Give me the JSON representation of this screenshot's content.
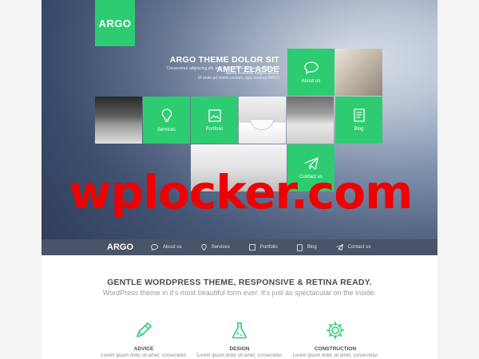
{
  "brand": {
    "logo": "ARGO",
    "accent_color": "#2ecc71",
    "watermark_color": "#f00000"
  },
  "hero": {
    "headline": "ARGO THEME DOLOR SIT AMET ELASDE",
    "subtext_1": "Consectetur adipiscing elit, sed do eiusmod tempor incididunt ut",
    "subtext_2": "labore et dolore magna aliqua.",
    "subtext_3": "Ut enim ad minim veniam, quis nostrud ARGO",
    "tiles": [
      {
        "label": "About us",
        "icon": "speech-bubble-icon"
      },
      {
        "label": "Services",
        "icon": "lightbulb-icon"
      },
      {
        "label": "Portfolio",
        "icon": "picture-frame-icon"
      },
      {
        "label": "Blog",
        "icon": "document-icon"
      },
      {
        "label": "Contact us",
        "icon": "paper-plane-icon"
      }
    ]
  },
  "watermark": "wplocker.com",
  "navbar": {
    "logo": "ARGO",
    "items": [
      {
        "label": "About us",
        "icon": "speech-bubble-icon"
      },
      {
        "label": "Services",
        "icon": "lightbulb-icon"
      },
      {
        "label": "Portfolio",
        "icon": "picture-frame-icon"
      },
      {
        "label": "Blog",
        "icon": "document-icon"
      },
      {
        "label": "Contact us",
        "icon": "paper-plane-icon"
      }
    ]
  },
  "intro": {
    "tagline": "GENTLE WORDPRESS THEME, RESPONSIVE & RETINA READY.",
    "subline": "WordPress theme in it's most beautiful form ever. It's just as spectacular on the inside."
  },
  "features": [
    {
      "title": "ADVICE",
      "desc": "Lorem ipsum dolor sit amet, consectetur",
      "icon": "pencil-icon"
    },
    {
      "title": "DESIGN",
      "desc": "Lorem ipsum dolor sit amet, consectetur",
      "icon": "flask-icon"
    },
    {
      "title": "CONSTRUCTION",
      "desc": "Lorem ipsum dolor sit amet, consectetur",
      "icon": "cog-icon"
    }
  ]
}
